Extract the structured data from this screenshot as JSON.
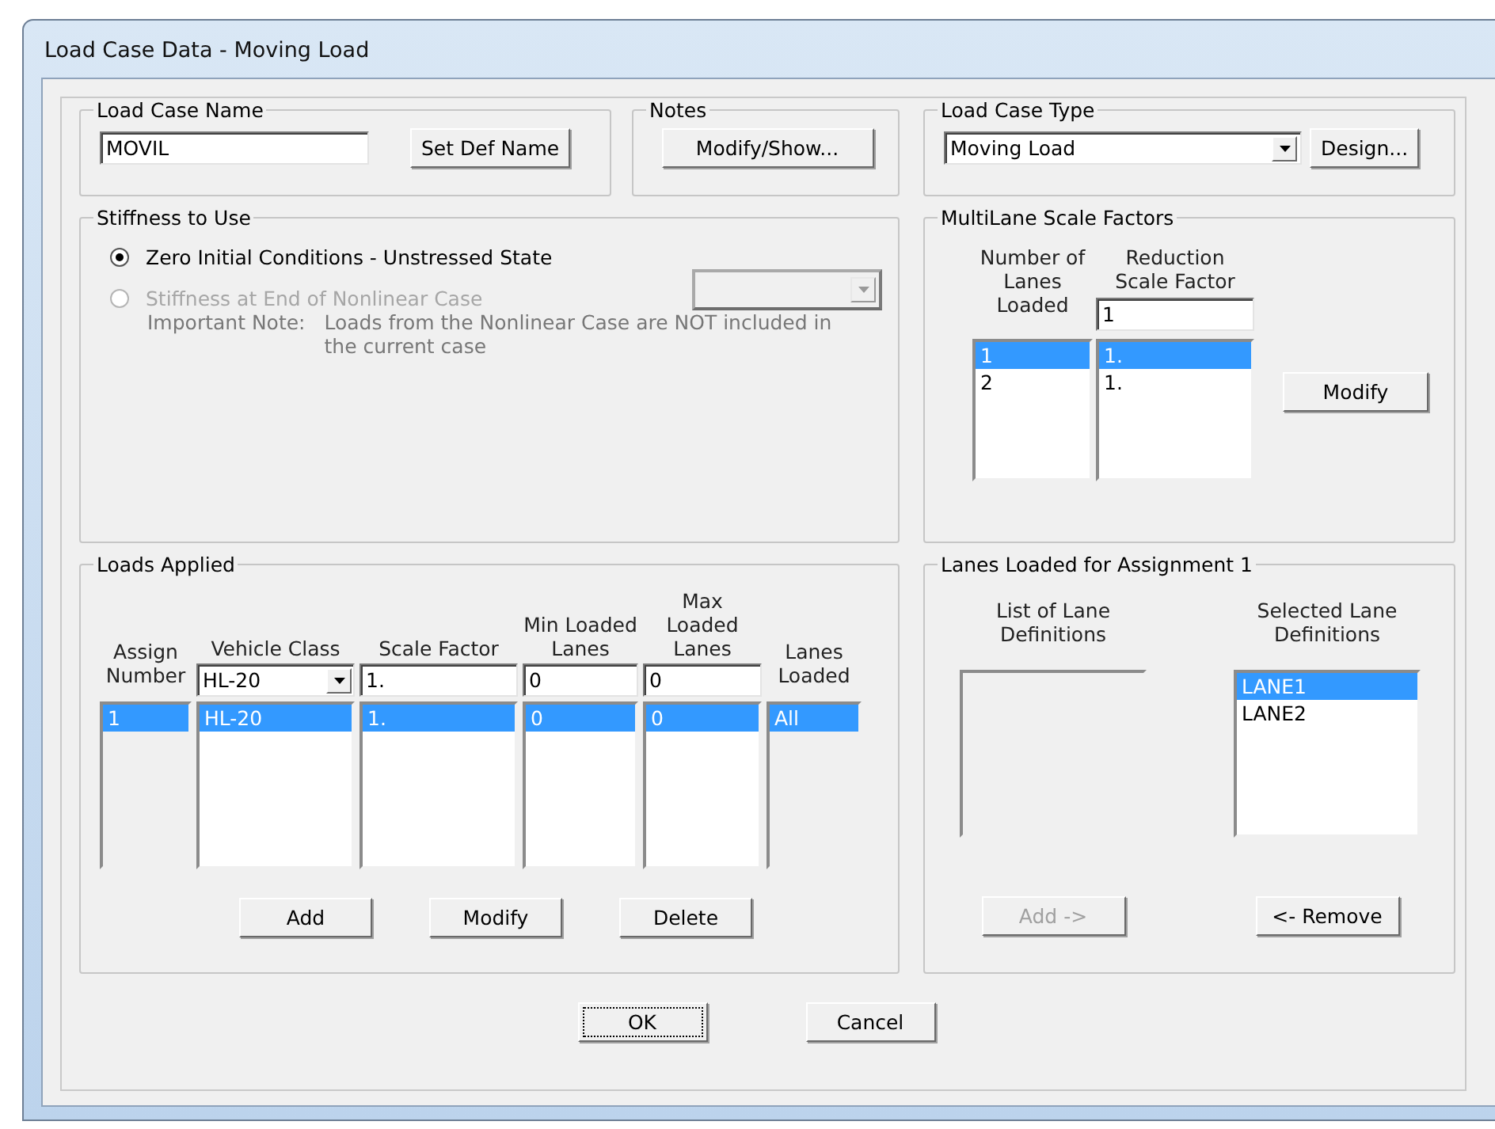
{
  "window": {
    "title": "Load Case Data - Moving Load"
  },
  "load_case_name": {
    "label": "Load Case Name",
    "value": "MOVIL",
    "button": "Set Def Name"
  },
  "notes": {
    "label": "Notes",
    "button": "Modify/Show..."
  },
  "load_case_type": {
    "label": "Load Case Type",
    "value": "Moving Load",
    "button": "Design..."
  },
  "stiffness": {
    "label": "Stiffness to Use",
    "options": [
      {
        "label": "Zero Initial Conditions - Unstressed State",
        "selected": true,
        "disabled": false
      },
      {
        "label": "Stiffness at End of Nonlinear Case",
        "selected": false,
        "disabled": true
      }
    ],
    "note_label": "Important Note:",
    "note_text": "Loads from the Nonlinear Case are NOT included in the current case"
  },
  "multilane": {
    "label": "MultiLane Scale Factors",
    "columns": [
      "Number of Lanes Loaded",
      "Reduction Scale Factor"
    ],
    "input": "1",
    "rows": [
      {
        "lanes": "1",
        "factor": "1.",
        "selected": true
      },
      {
        "lanes": "2",
        "factor": "1.",
        "selected": false
      }
    ],
    "button": "Modify"
  },
  "loads_applied": {
    "label": "Loads Applied",
    "columns": [
      "Assign Number",
      "Vehicle Class",
      "Scale Factor",
      "Min Loaded Lanes",
      "Max Loaded Lanes",
      "Lanes Loaded"
    ],
    "inputs": {
      "vehicle_class": "HL-20",
      "scale_factor": "1.",
      "min_lanes": "0",
      "max_lanes": "0"
    },
    "rows": [
      {
        "cells": [
          "1",
          "HL-20",
          "1.",
          "0",
          "0",
          "All"
        ],
        "selected": true
      }
    ],
    "buttons": [
      "Add",
      "Modify",
      "Delete"
    ]
  },
  "lanes_loaded": {
    "label": "Lanes Loaded for Assignment 1",
    "available_label": "List of Lane Definitions",
    "selected_label": "Selected Lane Definitions",
    "selected_items": [
      {
        "label": "LANE1",
        "selected": true
      },
      {
        "label": "LANE2",
        "selected": false
      }
    ],
    "buttons": [
      {
        "label": "Add ->",
        "disabled": true
      },
      {
        "label": "<- Remove",
        "disabled": false
      }
    ]
  },
  "buttons": [
    {
      "label": "OK",
      "focused": true
    },
    {
      "label": "Cancel",
      "focused": false
    }
  ]
}
